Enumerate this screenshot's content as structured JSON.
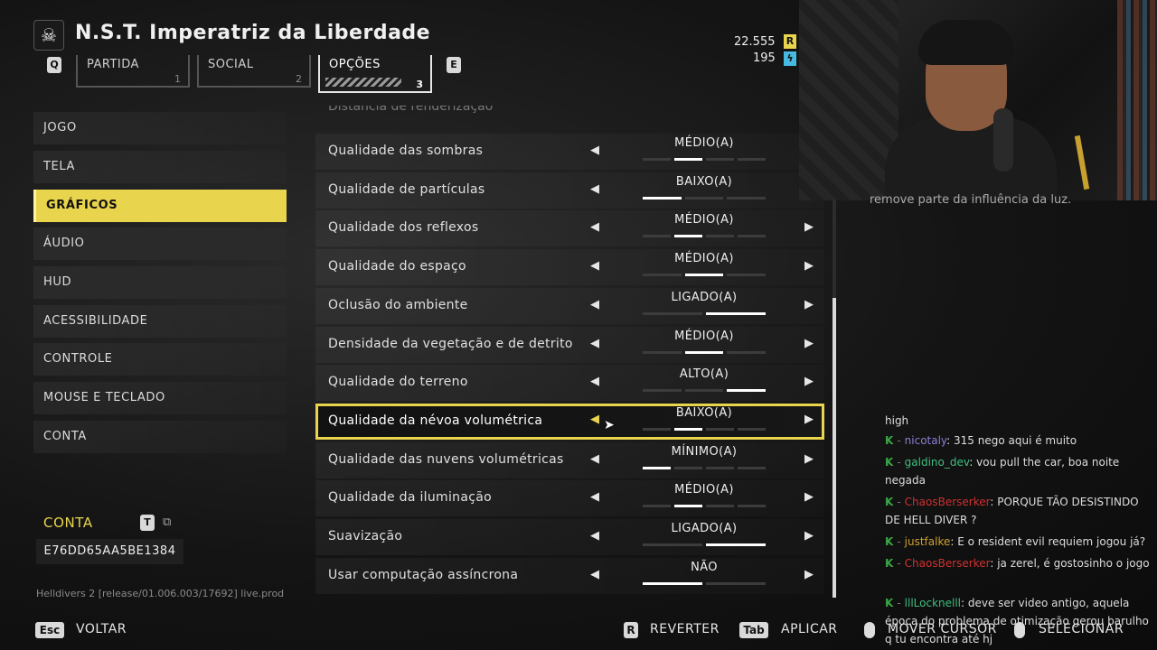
{
  "header": {
    "title": "N.S.T. Imperatriz da Liberdade",
    "key_q": "Q",
    "key_e": "E",
    "tabs": [
      {
        "label": "PARTIDA",
        "num": "1"
      },
      {
        "label": "SOCIAL",
        "num": "2"
      },
      {
        "label": "OPÇÕES",
        "num": "3"
      }
    ],
    "currency1": "22.555",
    "currency1_icon": "R",
    "currency2": "195",
    "currency2_icon": "ϟ"
  },
  "sidebar": {
    "items": [
      "JOGO",
      "TELA",
      "GRÁFICOS",
      "ÁUDIO",
      "HUD",
      "ACESSIBILIDADE",
      "CONTROLE",
      "MOUSE E TECLADO",
      "CONTA"
    ],
    "active_index": 2,
    "conta_label": "CONTA",
    "key_t": "T",
    "account_id": "E76DD65AA5BE1384",
    "build": "Helldivers 2 [release/01.006.003/17692] live.prod"
  },
  "settings": {
    "partial_label": "Distância de renderização",
    "rows": [
      {
        "name": "Qualidade das sombras",
        "value": "MÉDIO(A)",
        "level": 2,
        "steps": 4,
        "right_arrow": false
      },
      {
        "name": "Qualidade de partículas",
        "value": "BAIXO(A)",
        "level": 1,
        "steps": 3,
        "right_arrow": false
      },
      {
        "name": "Qualidade dos reflexos",
        "value": "MÉDIO(A)",
        "level": 2,
        "steps": 4,
        "right_arrow": true
      },
      {
        "name": "Qualidade do espaço",
        "value": "MÉDIO(A)",
        "level": 2,
        "steps": 3,
        "right_arrow": true
      },
      {
        "name": "Oclusão do ambiente",
        "value": "LIGADO(A)",
        "level": 2,
        "steps": 2,
        "right_arrow": true
      },
      {
        "name": "Densidade da vegetação e de detrito",
        "value": "MÉDIO(A)",
        "level": 2,
        "steps": 3,
        "right_arrow": true
      },
      {
        "name": "Qualidade do terreno",
        "value": "ALTO(A)",
        "level": 3,
        "steps": 3,
        "right_arrow": true
      },
      {
        "name": "Qualidade da névoa volumétrica",
        "value": "BAIXO(A)",
        "level": 2,
        "steps": 4,
        "right_arrow": true
      },
      {
        "name": "Qualidade das nuvens volumétricas",
        "value": "MÍNIMO(A)",
        "level": 1,
        "steps": 4,
        "right_arrow": true
      },
      {
        "name": "Qualidade da iluminação",
        "value": "MÉDIO(A)",
        "level": 2,
        "steps": 4,
        "right_arrow": true
      },
      {
        "name": "Suavização",
        "value": "LIGADO(A)",
        "level": 2,
        "steps": 2,
        "right_arrow": true
      },
      {
        "name": "Usar computação assíncrona",
        "value": "NÃO",
        "level": 1,
        "steps": 2,
        "right_arrow": true
      }
    ],
    "selected_index": 7
  },
  "stream": {
    "caption_cut": "remove parte da influência da luz.",
    "chat": [
      {
        "user": "",
        "msg": "high",
        "color": "#aaaaaa",
        "badge": false
      },
      {
        "user": "nicotaly",
        "msg": ": 315 nego aqui é muito",
        "color": "#8a7fd4",
        "badge": true
      },
      {
        "user": "galdino_dev",
        "msg": ": vou pull the car, boa noite negada",
        "color": "#3fbf7f",
        "badge": true
      },
      {
        "user": "ChaosBerserker",
        "msg": ": PORQUE TÃO DESISTINDO DE HELL DIVER ?",
        "color": "#d03030",
        "badge": true
      },
      {
        "user": "justfalke",
        "msg": ": E o resident evil requiem jogou já?",
        "color": "#d0a030",
        "badge": true
      },
      {
        "user": "ChaosBerserker",
        "msg": ": ja zerel, é gostosinho o jogo",
        "color": "#d03030",
        "badge": true
      },
      {
        "user": "lllLocknelll",
        "msg": ": deve ser video antigo, aquela época do problema de otimização gerou barulho q tu encontra até hj",
        "color": "#3fbf7f",
        "badge": true
      }
    ]
  },
  "footer": {
    "esc_key": "Esc",
    "voltar": "VOLTAR",
    "r_key": "R",
    "reverter": "REVERTER",
    "tab_key": "Tab",
    "aplicar": "APLICAR",
    "mover": "MOVER CURSOR",
    "selecionar": "SELECIONAR"
  },
  "colors": {
    "accent": "#e8d44d",
    "background": "#141414"
  }
}
